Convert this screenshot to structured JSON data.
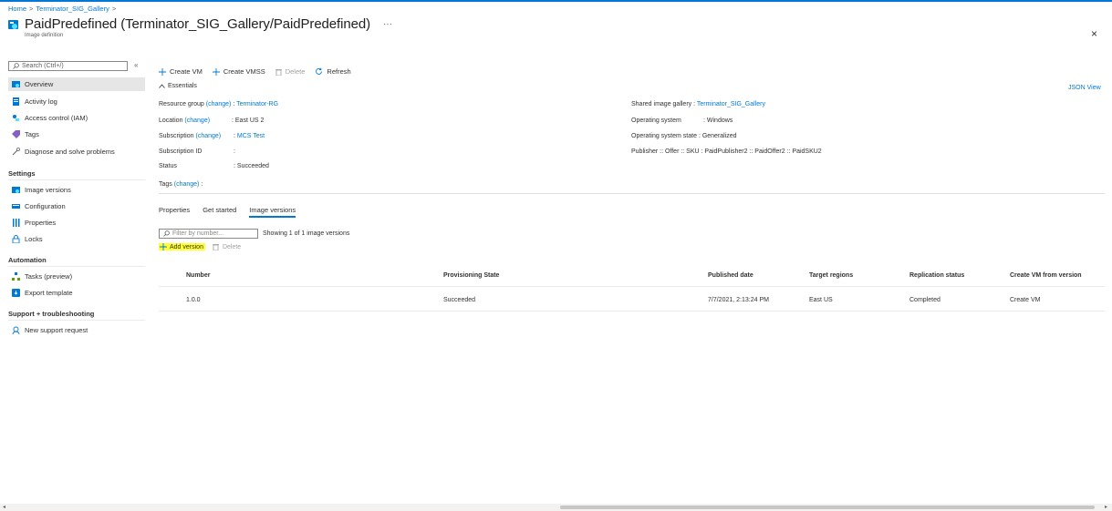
{
  "breadcrumb": {
    "home": "Home",
    "gallery": "Terminator_SIG_Gallery",
    "sep": ">"
  },
  "header": {
    "title": "PaidPredefined (Terminator_SIG_Gallery/PaidPredefined)",
    "subtitle": "Image definition",
    "ellipsis": "···",
    "close": "×"
  },
  "sidebar": {
    "search_placeholder": "Search (Ctrl+/)",
    "collapse": "«",
    "items": [
      {
        "label": "Overview",
        "icon": "overview-icon"
      },
      {
        "label": "Activity log",
        "icon": "activity-log-icon"
      },
      {
        "label": "Access control (IAM)",
        "icon": "iam-icon"
      },
      {
        "label": "Tags",
        "icon": "tag-icon"
      },
      {
        "label": "Diagnose and solve problems",
        "icon": "wrench-icon"
      }
    ],
    "settings_head": "Settings",
    "settings": [
      {
        "label": "Image versions",
        "icon": "image-versions-icon"
      },
      {
        "label": "Configuration",
        "icon": "configuration-icon"
      },
      {
        "label": "Properties",
        "icon": "properties-icon"
      },
      {
        "label": "Locks",
        "icon": "lock-icon"
      }
    ],
    "automation_head": "Automation",
    "automation": [
      {
        "label": "Tasks (preview)",
        "icon": "tasks-icon"
      },
      {
        "label": "Export template",
        "icon": "export-template-icon"
      }
    ],
    "support_head": "Support + troubleshooting",
    "support": [
      {
        "label": "New support request",
        "icon": "support-icon"
      }
    ]
  },
  "toolbar": {
    "create_vm": "Create VM",
    "create_vmss": "Create VMSS",
    "delete": "Delete",
    "refresh": "Refresh"
  },
  "essentials": {
    "toggle": "Essentials",
    "json_view": "JSON View",
    "change": "(change)",
    "resource_group_label": "Resource group",
    "resource_group_value": "Terminator-RG",
    "location_label": "Location",
    "location_value": ": East US 2",
    "subscription_label": "Subscription",
    "subscription_value": "MCS Test",
    "subscription_id_label": "Subscription ID",
    "subscription_id_value": ":",
    "status_label": "Status",
    "status_value": ": Succeeded",
    "gallery_label": "Shared image gallery",
    "gallery_value": "Terminator_SIG_Gallery",
    "os_label": "Operating system",
    "os_value": ": Windows",
    "os_state_label": "Operating system state",
    "os_state_value": ": Generalized",
    "pos_label": "Publisher :: Offer :: SKU",
    "pos_value": ": PaidPublisher2 :: PaidOffer2 :: PaidSKU2",
    "tags_label": "Tags",
    "tags_suffix": ":"
  },
  "tabs": [
    "Properties",
    "Get started",
    "Image versions"
  ],
  "versions": {
    "filter_placeholder": "Filter by number...",
    "showing": "Showing 1 of 1 image versions",
    "add_version": "Add version",
    "delete": "Delete",
    "columns": [
      "Number",
      "Provisioning State",
      "Published date",
      "Target regions",
      "Replication status",
      "Create VM from version"
    ],
    "rows": [
      {
        "number": "1.0.0",
        "state": "Succeeded",
        "published": "7/7/2021, 2:13:24 PM",
        "regions": "East US",
        "replication": "Completed",
        "create": "Create VM"
      }
    ]
  },
  "colors": {
    "accent": "#0078d4",
    "highlight": "#ffff33"
  }
}
